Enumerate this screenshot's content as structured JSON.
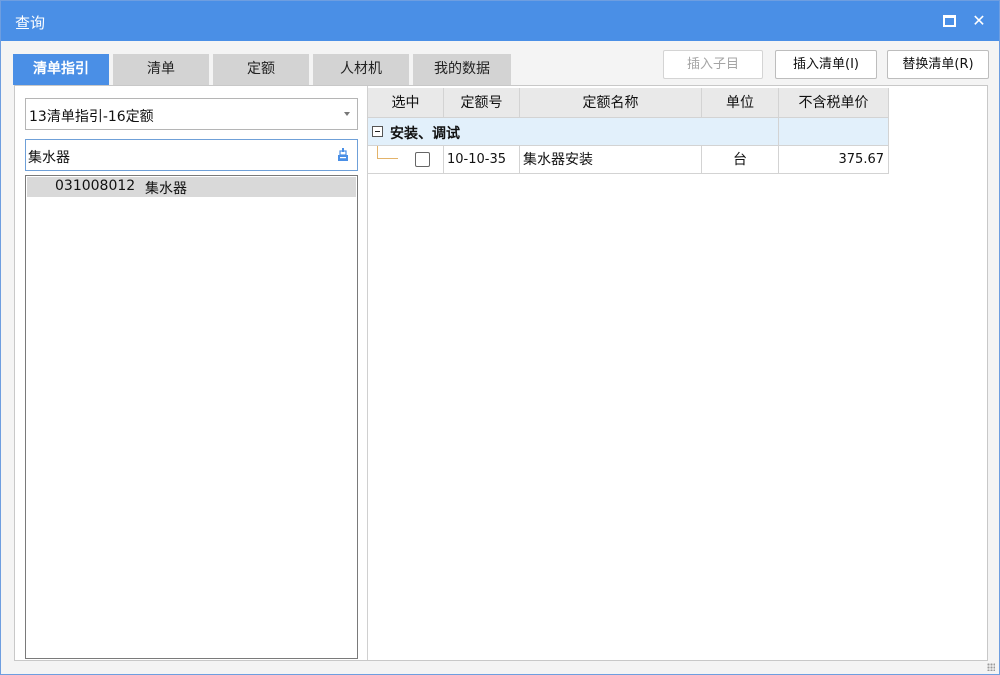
{
  "window": {
    "title": "查询"
  },
  "tabs": [
    {
      "label": "清单指引",
      "active": true
    },
    {
      "label": "清单",
      "active": false
    },
    {
      "label": "定额",
      "active": false
    },
    {
      "label": "人材机",
      "active": false
    },
    {
      "label": "我的数据",
      "active": false
    }
  ],
  "toolbar": {
    "insert_child_label": "插入子目",
    "insert_list_label": "插入清单(I)",
    "replace_list_label": "替换清单(R)"
  },
  "left_panel": {
    "library_select": "13清单指引-16定额",
    "search_value": "集水器",
    "tree_items": [
      {
        "code": "031008012",
        "name": "集水器",
        "selected": true
      }
    ]
  },
  "grid": {
    "columns": [
      "选中",
      "定额号",
      "定额名称",
      "单位",
      "不含税单价"
    ],
    "groups": [
      {
        "name": "安装、调试",
        "expanded": true,
        "rows": [
          {
            "checked": false,
            "quota_no": "10-10-35",
            "quota_name": "集水器安装",
            "unit": "台",
            "price": "375.67"
          }
        ]
      }
    ]
  },
  "colors": {
    "accent": "#4a8fe6",
    "group_row_bg": "#e2f0fb",
    "header_bg": "#e9e9e9"
  }
}
